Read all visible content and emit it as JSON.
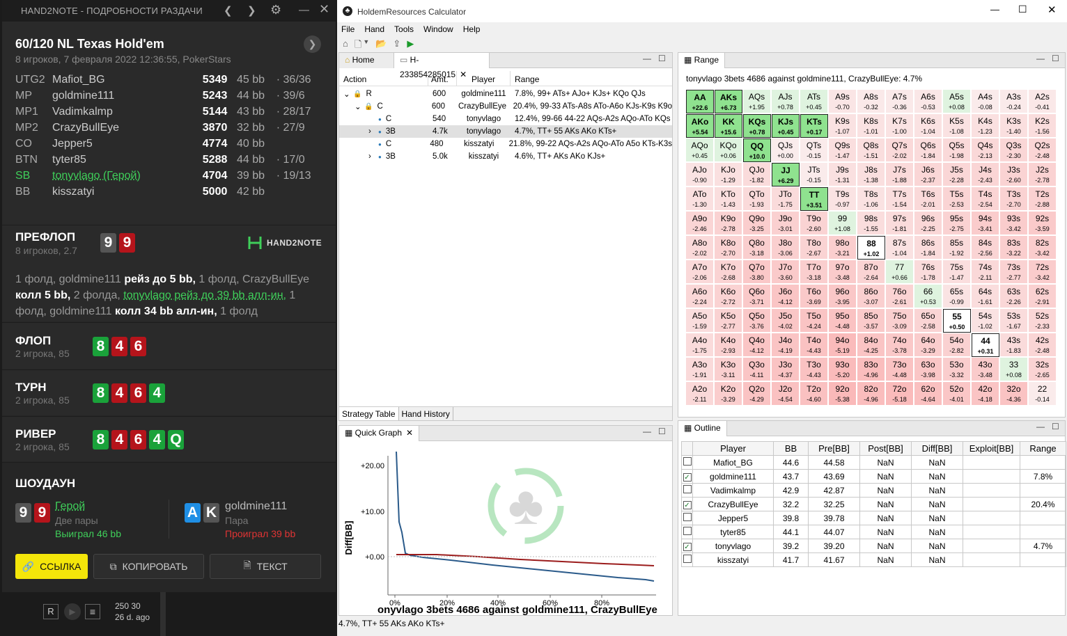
{
  "h2n": {
    "window_title": "HAND2NOTE - ПОДРОБНОСТИ РАЗДАЧИ",
    "game": "60/120 NL Texas Hold'em",
    "subtitle": "8 игроков, 7 февраля 2022 12:36:55, PokerStars",
    "players": [
      {
        "pos": "UTG2",
        "name": "Mafiot_BG",
        "stack": "5349",
        "bb": "45 bb",
        "vpip": "· 36/36"
      },
      {
        "pos": "MP",
        "name": "goldmine111",
        "stack": "5243",
        "bb": "44 bb",
        "vpip": "· 39/6"
      },
      {
        "pos": "MP1",
        "name": "Vadimkalmp",
        "stack": "5144",
        "bb": "43 bb",
        "vpip": "· 28/17"
      },
      {
        "pos": "MP2",
        "name": "CrazyBullEye",
        "stack": "3870",
        "bb": "32 bb",
        "vpip": "· 27/9"
      },
      {
        "pos": "CO",
        "name": "Jepper5",
        "stack": "4774",
        "bb": "40 bb",
        "vpip": ""
      },
      {
        "pos": "BTN",
        "name": "tyter85",
        "stack": "5288",
        "bb": "44 bb",
        "vpip": "· 17/0"
      },
      {
        "pos": "SB",
        "name": "tonyvlago (Герой)",
        "stack": "4704",
        "bb": "39 bb",
        "vpip": "· 19/13"
      },
      {
        "pos": "BB",
        "name": "kisszatyi",
        "stack": "5000",
        "bb": "42 bb",
        "vpip": ""
      }
    ],
    "preflop": {
      "title": "ПРЕФЛОП",
      "sub": "8 игроков, 2.7",
      "logo": "HAND2NOTE",
      "t1": "1 фолд, goldmine111 ",
      "t2": "рейз до 5 bb,",
      "t3": " 1 фолд, CrazyBullEye",
      "t4": "колл 5 bb,",
      "t5": " 2 фолда, ",
      "t6": "tonyvlago рейз до 39 bb алл-ин,",
      "t7": " 1",
      "t8": "фолд, goldmine111 ",
      "t9": "колл 34 bb алл-ин,",
      "t10": " 1 фолд"
    },
    "hero_cards": [
      "9",
      "9"
    ],
    "flop": {
      "title": "ФЛОП",
      "sub": "2 игрока, 85",
      "cards": [
        "8",
        "4",
        "6"
      ]
    },
    "turn": {
      "title": "ТУРН",
      "sub": "2 игрока, 85",
      "cards": [
        "8",
        "4",
        "6",
        "4"
      ]
    },
    "river": {
      "title": "РИВЕР",
      "sub": "2 игрока, 85",
      "cards": [
        "8",
        "4",
        "6",
        "4",
        "Q"
      ]
    },
    "showdown": {
      "title": "ШОУДАУН",
      "hero": "Герой",
      "hero_hand": "Две пары",
      "hero_res": "Выиграл 46 bb",
      "villain": "goldmine111",
      "villain_hand": "Пара",
      "villain_res": "Проиграл 39 bb",
      "villain_cards": [
        "A",
        "K"
      ]
    },
    "buttons": {
      "link": "ССЫЛКА",
      "copy": "КОПИРОВАТЬ",
      "text": "ТЕКСТ"
    },
    "bottom": {
      "r": "R",
      "stakes": "250 30",
      "ago": "26 d. ago"
    }
  },
  "hrc": {
    "title": "HoldemResources Calculator",
    "menu": [
      "File",
      "Hand",
      "Tools",
      "Window",
      "Help"
    ],
    "tabs": {
      "home": "Home",
      "hand": "H-233854285015"
    },
    "st_headers": [
      "Action",
      "Amt.",
      "Player",
      "Range"
    ],
    "st_rows": [
      {
        "a": "R",
        "amt": "600",
        "p": "goldmine111",
        "r": "7.8%, 99+ ATs+ AJo+ KJs+ KQo QJs"
      },
      {
        "a": "C",
        "amt": "600",
        "p": "CrazyBullEye",
        "r": "20.4%, 99-33 ATs-A8s ATo-A6o KJs-K9s K9o"
      },
      {
        "a": "C",
        "amt": "540",
        "p": "tonyvlago",
        "r": "12.4%, 99-66 44-22 AQs-A2s AQo-ATo KQs"
      },
      {
        "a": "3B",
        "amt": "4.7k",
        "p": "tonyvlago",
        "r": "4.7%, TT+ 55 AKs AKo KTs+"
      },
      {
        "a": "C",
        "amt": "480",
        "p": "kisszatyi",
        "r": "21.8%, 99-22 AQs-A2s AQo-ATo A5o KTs-K3s"
      },
      {
        "a": "3B",
        "amt": "5.0k",
        "p": "kisszatyi",
        "r": "4.6%, TT+ AKs AKo KJs+"
      }
    ],
    "bottom_tabs": [
      "Strategy Table",
      "Hand History"
    ],
    "quick_graph": "Quick Graph",
    "chart_data": {
      "type": "line",
      "ylabel": "Diff[BB]",
      "yticks": [
        "+20.00",
        "+10.00",
        "+0.00"
      ],
      "xticks": [
        "0%",
        "20%",
        "40%",
        "60%",
        "80%"
      ],
      "title": "onyvlago 3bets 4686 against goldmine111, CrazyBullEye",
      "series": [
        {
          "color": "#2a5a8a"
        },
        {
          "color": "#9b1c1c"
        }
      ]
    },
    "range_tab": "Range",
    "range_title": "tonyvlago 3bets 4686 against goldmine111, CrazyBullEye: 4.7%",
    "outline_tab": "Outline",
    "outline_headers": [
      "Player",
      "BB",
      "Pre[BB]",
      "Post[BB]",
      "Diff[BB]",
      "Exploit[BB]",
      "Range"
    ],
    "outline_rows": [
      {
        "c": false,
        "p": "Mafiot_BG",
        "bb": "44.6",
        "pre": "44.58",
        "post": "NaN",
        "diff": "NaN",
        "ex": "",
        "r": ""
      },
      {
        "c": true,
        "p": "goldmine111",
        "bb": "43.7",
        "pre": "43.69",
        "post": "NaN",
        "diff": "NaN",
        "ex": "",
        "r": "7.8%"
      },
      {
        "c": false,
        "p": "Vadimkalmp",
        "bb": "42.9",
        "pre": "42.87",
        "post": "NaN",
        "diff": "NaN",
        "ex": "",
        "r": ""
      },
      {
        "c": true,
        "p": "CrazyBullEye",
        "bb": "32.2",
        "pre": "32.25",
        "post": "NaN",
        "diff": "NaN",
        "ex": "",
        "r": "20.4%"
      },
      {
        "c": false,
        "p": "Jepper5",
        "bb": "39.8",
        "pre": "39.78",
        "post": "NaN",
        "diff": "NaN",
        "ex": "",
        "r": ""
      },
      {
        "c": false,
        "p": "tyter85",
        "bb": "44.1",
        "pre": "44.07",
        "post": "NaN",
        "diff": "NaN",
        "ex": "",
        "r": ""
      },
      {
        "c": true,
        "p": "tonyvlago",
        "bb": "39.2",
        "pre": "39.20",
        "post": "NaN",
        "diff": "NaN",
        "ex": "",
        "r": "4.7%"
      },
      {
        "c": false,
        "p": "kisszatyi",
        "bb": "41.7",
        "pre": "41.67",
        "post": "NaN",
        "diff": "NaN",
        "ex": "",
        "r": ""
      }
    ],
    "status": "4.7%, TT+ 55 AKs AKo KTs+"
  },
  "grid": {
    "hands": [
      [
        "AA",
        "AKs",
        "AQs",
        "AJs",
        "ATs",
        "A9s",
        "A8s",
        "A7s",
        "A6s",
        "A5s",
        "A4s",
        "A3s",
        "A2s"
      ],
      [
        "AKo",
        "KK",
        "KQs",
        "KJs",
        "KTs",
        "K9s",
        "K8s",
        "K7s",
        "K6s",
        "K5s",
        "K4s",
        "K3s",
        "K2s"
      ],
      [
        "AQo",
        "KQo",
        "QQ",
        "QJs",
        "QTs",
        "Q9s",
        "Q8s",
        "Q7s",
        "Q6s",
        "Q5s",
        "Q4s",
        "Q3s",
        "Q2s"
      ],
      [
        "AJo",
        "KJo",
        "QJo",
        "JJ",
        "JTs",
        "J9s",
        "J8s",
        "J7s",
        "J6s",
        "J5s",
        "J4s",
        "J3s",
        "J2s"
      ],
      [
        "ATo",
        "KTo",
        "QTo",
        "JTo",
        "TT",
        "T9s",
        "T8s",
        "T7s",
        "T6s",
        "T5s",
        "T4s",
        "T3s",
        "T2s"
      ],
      [
        "A9o",
        "K9o",
        "Q9o",
        "J9o",
        "T9o",
        "99",
        "98s",
        "97s",
        "96s",
        "95s",
        "94s",
        "93s",
        "92s"
      ],
      [
        "A8o",
        "K8o",
        "Q8o",
        "J8o",
        "T8o",
        "98o",
        "88",
        "87s",
        "86s",
        "85s",
        "84s",
        "83s",
        "82s"
      ],
      [
        "A7o",
        "K7o",
        "Q7o",
        "J7o",
        "T7o",
        "97o",
        "87o",
        "77",
        "76s",
        "75s",
        "74s",
        "73s",
        "72s"
      ],
      [
        "A6o",
        "K6o",
        "Q6o",
        "J6o",
        "T6o",
        "96o",
        "86o",
        "76o",
        "66",
        "65s",
        "64s",
        "63s",
        "62s"
      ],
      [
        "A5o",
        "K5o",
        "Q5o",
        "J5o",
        "T5o",
        "95o",
        "85o",
        "75o",
        "65o",
        "55",
        "54s",
        "53s",
        "52s"
      ],
      [
        "A4o",
        "K4o",
        "Q4o",
        "J4o",
        "T4o",
        "94o",
        "84o",
        "74o",
        "64o",
        "54o",
        "44",
        "43s",
        "42s"
      ],
      [
        "A3o",
        "K3o",
        "Q3o",
        "J3o",
        "T3o",
        "93o",
        "83o",
        "73o",
        "63o",
        "53o",
        "43o",
        "33",
        "32s"
      ],
      [
        "A2o",
        "K2o",
        "Q2o",
        "J2o",
        "T2o",
        "92o",
        "82o",
        "72o",
        "62o",
        "52o",
        "42o",
        "32o",
        "22"
      ]
    ],
    "values": [
      [
        "+22.6",
        "+6.73",
        "+1.95",
        "+0.78",
        "+0.45",
        "-0.70",
        "-0.32",
        "-0.36",
        "-0.53",
        "+0.08",
        "-0.08",
        "-0.24",
        "-0.41"
      ],
      [
        "+5.54",
        "+15.6",
        "+0.78",
        "+0.45",
        "+0.17",
        "-1.07",
        "-1.01",
        "-1.00",
        "-1.04",
        "-1.08",
        "-1.23",
        "-1.40",
        "-1.56"
      ],
      [
        "+0.45",
        "+0.06",
        "+10.0",
        "+0.00",
        "-0.15",
        "-1.47",
        "-1.51",
        "-2.02",
        "-1.84",
        "-1.98",
        "-2.13",
        "-2.30",
        "-2.48"
      ],
      [
        "-0.90",
        "-1.29",
        "-1.82",
        "+6.29",
        "-0.15",
        "-1.31",
        "-1.38",
        "-1.88",
        "-2.37",
        "-2.28",
        "-2.43",
        "-2.60",
        "-2.78"
      ],
      [
        "-1.30",
        "-1.43",
        "-1.93",
        "-1.75",
        "+3.51",
        "-0.97",
        "-1.06",
        "-1.54",
        "-2.01",
        "-2.53",
        "-2.54",
        "-2.70",
        "-2.88"
      ],
      [
        "-2.46",
        "-2.78",
        "-3.25",
        "-3.01",
        "-2.60",
        "+1.08",
        "-1.55",
        "-1.81",
        "-2.25",
        "-2.75",
        "-3.41",
        "-3.42",
        "-3.59"
      ],
      [
        "-2.02",
        "-2.70",
        "-3.18",
        "-3.06",
        "-2.67",
        "-3.21",
        "+1.02",
        "-1.04",
        "-1.84",
        "-1.92",
        "-2.56",
        "-3.22",
        "-3.42"
      ],
      [
        "-2.06",
        "-2.68",
        "-3.80",
        "-3.60",
        "-3.18",
        "-3.48",
        "-2.64",
        "+0.66",
        "-1.78",
        "-1.47",
        "-2.11",
        "-2.77",
        "-3.42"
      ],
      [
        "-2.24",
        "-2.72",
        "-3.71",
        "-4.12",
        "-3.69",
        "-3.95",
        "-3.07",
        "-2.61",
        "+0.53",
        "-0.99",
        "-1.61",
        "-2.26",
        "-2.91"
      ],
      [
        "-1.59",
        "-2.77",
        "-3.76",
        "-4.02",
        "-4.24",
        "-4.48",
        "-3.57",
        "-3.09",
        "-2.58",
        "+0.50",
        "-1.02",
        "-1.67",
        "-2.33"
      ],
      [
        "-1.75",
        "-2.93",
        "-4.12",
        "-4.19",
        "-4.43",
        "-5.19",
        "-4.25",
        "-3.78",
        "-3.29",
        "-2.82",
        "+0.31",
        "-1.83",
        "-2.48"
      ],
      [
        "-1.91",
        "-3.11",
        "-4.11",
        "-4.37",
        "-4.43",
        "-5.20",
        "-4.96",
        "-4.48",
        "-3.98",
        "-3.32",
        "-3.48",
        "+0.08",
        "-2.65"
      ],
      [
        "-2.11",
        "-3.29",
        "-4.29",
        "-4.54",
        "-4.60",
        "-5.38",
        "-4.96",
        "-5.18",
        "-4.64",
        "-4.01",
        "-4.18",
        "-4.36",
        "-0.14"
      ]
    ],
    "selected": [
      "AA",
      "AKs",
      "AKo",
      "KK",
      "KQs",
      "KJs",
      "KTs",
      "QQ",
      "JJ",
      "TT",
      "88",
      "55",
      "44"
    ]
  }
}
